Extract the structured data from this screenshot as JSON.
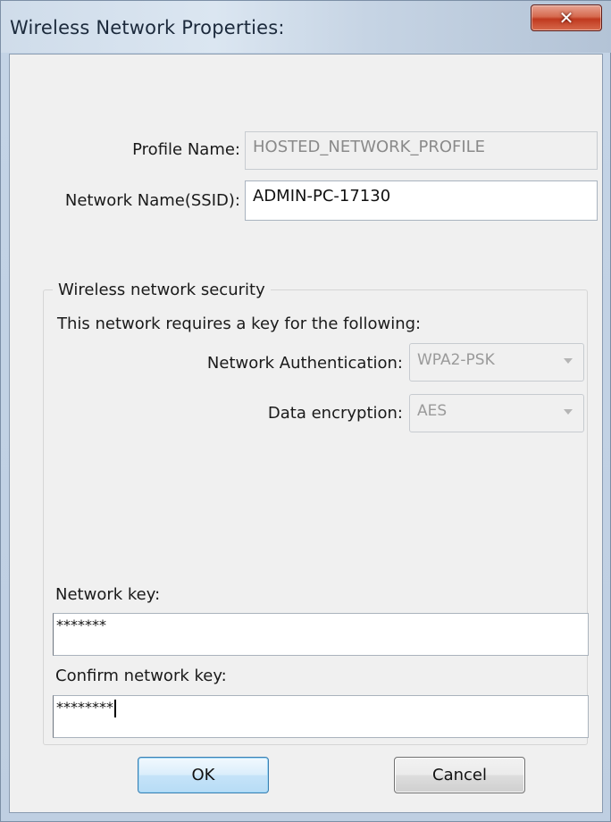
{
  "window": {
    "title": "Wireless Network Properties:",
    "close_glyph": "✕"
  },
  "form": {
    "profile_name_label": "Profile Name:",
    "profile_name_value": "HOSTED_NETWORK_PROFILE",
    "ssid_label": "Network Name(SSID):",
    "ssid_value": "ADMIN-PC-17130"
  },
  "security": {
    "group_title": "Wireless network security",
    "description": "This network requires a key for the following:",
    "auth_label": "Network Authentication:",
    "auth_value": "WPA2-PSK",
    "encryption_label": "Data encryption:",
    "encryption_value": "AES",
    "network_key_label": "Network key:",
    "network_key_value": "*******",
    "confirm_key_label": "Confirm network key:",
    "confirm_key_value": "********"
  },
  "buttons": {
    "ok": "OK",
    "cancel": "Cancel"
  },
  "icons": {
    "close": "close-icon",
    "dropdown": "chevron-down-icon"
  },
  "colors": {
    "close_button": "#c0391f",
    "ok_border": "#3c7fb1",
    "disabled_text": "#8a8a8a"
  }
}
